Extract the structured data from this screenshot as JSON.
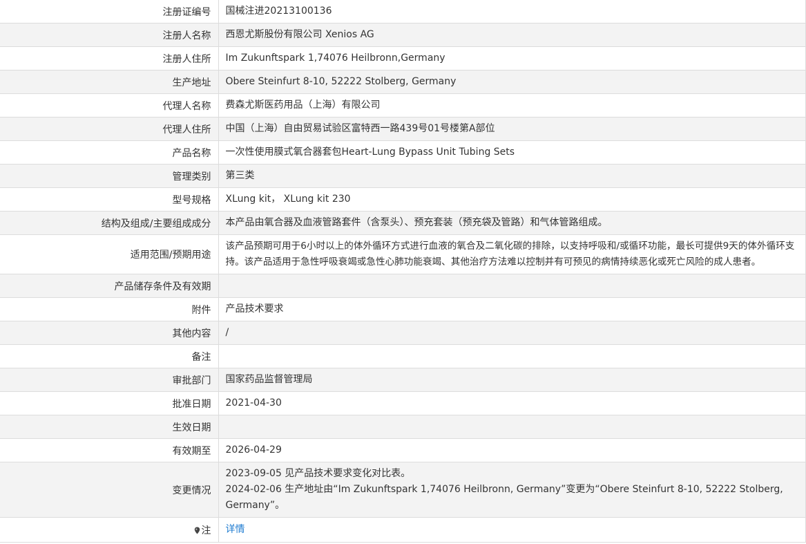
{
  "rows": [
    {
      "label": "注册证编号",
      "value": "国械注进20213100136"
    },
    {
      "label": "注册人名称",
      "value": "西恩尤斯股份有限公司 Xenios AG"
    },
    {
      "label": "注册人住所",
      "value": "Im Zukunftspark 1,74076 Heilbronn,Germany"
    },
    {
      "label": "生产地址",
      "value": "Obere Steinfurt 8-10, 52222 Stolberg, Germany"
    },
    {
      "label": "代理人名称",
      "value": "费森尤斯医药用品（上海）有限公司"
    },
    {
      "label": "代理人住所",
      "value": "中国（上海）自由贸易试验区富特西一路439号01号楼第A部位"
    },
    {
      "label": "产品名称",
      "value": "一次性使用膜式氧合器套包Heart-Lung Bypass Unit Tubing Sets"
    },
    {
      "label": "管理类别",
      "value": "第三类"
    },
    {
      "label": "型号规格",
      "value": "XLung kit， XLung kit 230"
    },
    {
      "label": "结构及组成/主要组成成分",
      "value": "本产品由氧合器及血液管路套件（含泵头）、预充套装（预充袋及管路）和气体管路组成。"
    },
    {
      "label": "适用范围/预期用途",
      "value": "该产品预期可用于6小时以上的体外循环方式进行血液的氧合及二氧化碳的排除，以支持呼吸和/或循环功能，最长可提供9天的体外循环支持。该产品适用于急性呼吸衰竭或急性心肺功能衰竭、其他治疗方法难以控制并有可预见的病情持续恶化或死亡风险的成人患者。"
    },
    {
      "label": "产品储存条件及有效期",
      "value": ""
    },
    {
      "label": "附件",
      "value": "产品技术要求"
    },
    {
      "label": "其他内容",
      "value": "/"
    },
    {
      "label": "备注",
      "value": ""
    },
    {
      "label": "审批部门",
      "value": "国家药品监督管理局"
    },
    {
      "label": "批准日期",
      "value": "2021-04-30"
    },
    {
      "label": "生效日期",
      "value": ""
    },
    {
      "label": "有效期至",
      "value": "2026-04-29"
    }
  ],
  "changes": {
    "label": "变更情况",
    "line1": "2023-09-05 见产品技术要求变化对比表。",
    "line2": "2024-02-06 生产地址由“Im Zukunftspark 1,74076 Heilbronn, Germany”变更为“Obere Steinfurt 8-10, 52222 Stolberg, Germany”。"
  },
  "note": {
    "label": "注",
    "icon": "map-pin-icon",
    "link": "详情",
    "link_color": "#1e7bd0"
  }
}
